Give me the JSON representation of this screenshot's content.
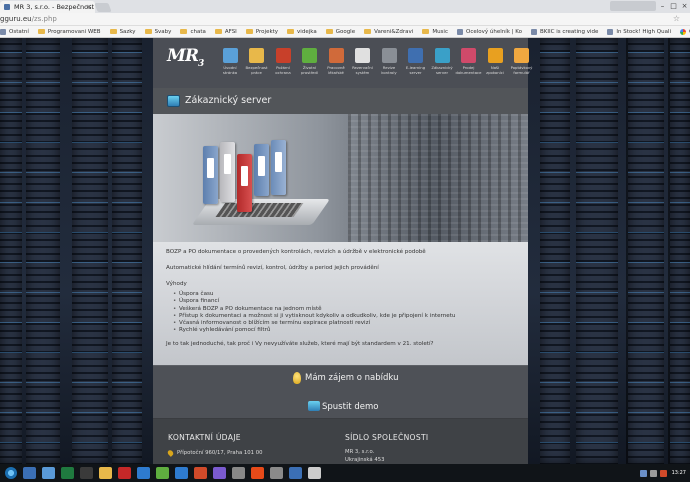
{
  "browser": {
    "tab_title": "MR 3, s.r.o. - Bezpečnost",
    "url_host": "gguru.eu",
    "url_path": "/zs.php",
    "bookmarks": [
      {
        "label": "Ostatní",
        "kind": "page"
      },
      {
        "label": "Programovani WEB",
        "kind": "folder"
      },
      {
        "label": "Sazky",
        "kind": "folder"
      },
      {
        "label": "Svaby",
        "kind": "folder"
      },
      {
        "label": "chata",
        "kind": "folder"
      },
      {
        "label": "AFSI",
        "kind": "folder"
      },
      {
        "label": "Projekty",
        "kind": "folder"
      },
      {
        "label": "videjka",
        "kind": "folder"
      },
      {
        "label": "Google",
        "kind": "folder"
      },
      {
        "label": "Vareni&Zdravi",
        "kind": "folder"
      },
      {
        "label": "Music",
        "kind": "folder"
      },
      {
        "label": "Ocelový úhelník | Ko",
        "kind": "page"
      },
      {
        "label": "BKIIC is creating vide",
        "kind": "page"
      },
      {
        "label": "In Stock! High Quali",
        "kind": "page"
      },
      {
        "label": "Google",
        "kind": "google"
      },
      {
        "label": "GDPR cirkus přijíždí",
        "kind": "page"
      }
    ]
  },
  "site": {
    "logo_main": "MR",
    "logo_sub": "3",
    "nav": [
      {
        "label": "Úvodní stránka",
        "color": "#5aa0d8"
      },
      {
        "label": "Bezpečnost práce",
        "color": "#e8b84a"
      },
      {
        "label": "Požární ochrana",
        "color": "#c8402a"
      },
      {
        "label": "Životní prostředí",
        "color": "#5fae3f"
      },
      {
        "label": "Pracovně lékařské",
        "color": "#d06a3a"
      },
      {
        "label": "Rezervační systém",
        "color": "#e0e0e0"
      },
      {
        "label": "Revize kontroly",
        "color": "#8a8f96"
      },
      {
        "label": "E-learning server",
        "color": "#3f6fb0"
      },
      {
        "label": "Zákaznický server",
        "color": "#3aa0c8"
      },
      {
        "label": "Prodej dokumentace",
        "color": "#d04a6a"
      },
      {
        "label": "Naši zpokoníci",
        "color": "#e8a020"
      },
      {
        "label": "Poptávkový formulář",
        "color": "#f0a840"
      }
    ],
    "section_title": "Zákaznický server",
    "intro_1": "BOZP a PO dokumentace o provedených kontrolách, revizích a údržbě v elektronické podobě",
    "intro_2": "Automatické hlídání termínů revizí, kontrol, údržby a period jejich provádění",
    "benefits_title": "Výhody",
    "benefits": [
      "Úspora času",
      "Úspora financí",
      "Veškerá BOZP a PO dokumentace na jednom místě",
      "Přístup k dokumentaci a možnost si ji vytisknout kdykoliv a odkudkoliv, kde je připojení k internetu",
      "Včasná informovanost o blížícím se termínu expirace platnosti revizí",
      "Rychlé vyhledávání pomocí filtrů"
    ],
    "closing": "Je to tak jednoduché, tak proč i Vy nevyužíváte služeb, které mají být standardem v 21. století?",
    "cta_interest": "Mám zájem o nabídku",
    "cta_demo": "Spustit demo",
    "footer": {
      "contact_heading": "KONTAKTNÍ ÚDAJE",
      "contact_address": "Přípotoční 960/17, Praha 101 00",
      "seat_heading": "SÍDLO SPOLEČNOSTI",
      "seat_company": "MR 3, s.r.o.",
      "seat_street": "Ukrajinská 453"
    }
  },
  "taskbar": {
    "clock": "13:27",
    "icons": [
      "#3b6fb5",
      "#5a9ad8",
      "#1f7a3f",
      "#3a3a3a",
      "#e8b84a",
      "#c62828",
      "#2e7bcf",
      "#5fae3f",
      "#2e7bcf",
      "#d04a2a",
      "#7a5acf",
      "#888888",
      "#e64a19",
      "#8a8a8a",
      "#3b6fb5",
      "#cccccc"
    ]
  }
}
